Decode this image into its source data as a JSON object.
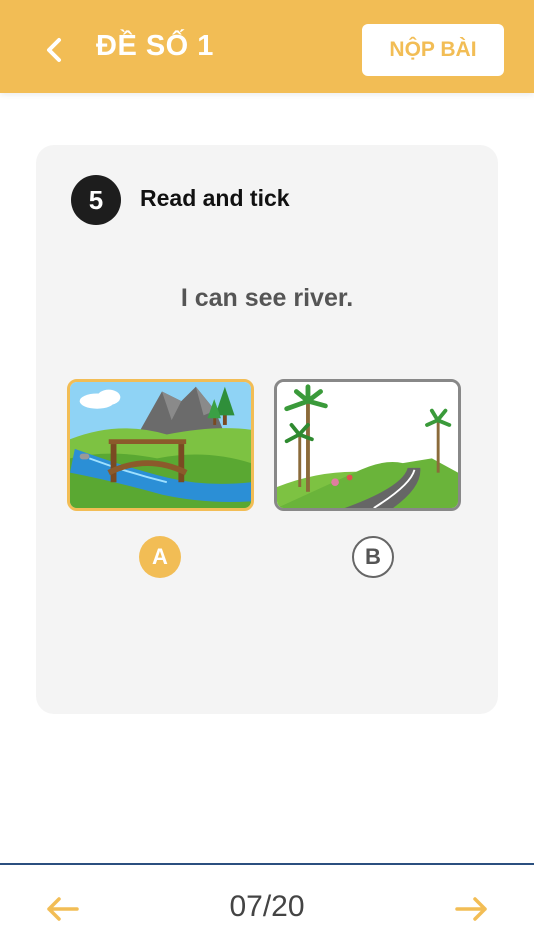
{
  "header": {
    "title": "ĐỀ SỐ 1",
    "submit_label": "NỘP BÀI",
    "back_icon": "chevron-left-icon"
  },
  "question": {
    "number": "5",
    "instruction": "Read and tick",
    "text": "I can see river.",
    "options": [
      {
        "letter": "A",
        "image": "river-bridge-image",
        "selected": true
      },
      {
        "letter": "B",
        "image": "road-palm-image",
        "selected": false
      }
    ]
  },
  "footer": {
    "progress": "07/20",
    "prev_icon": "arrow-left-icon",
    "next_icon": "arrow-right-icon"
  },
  "colors": {
    "accent": "#f2bd55",
    "card_bg": "#f4f4f4",
    "divider": "#2b4f7f"
  }
}
